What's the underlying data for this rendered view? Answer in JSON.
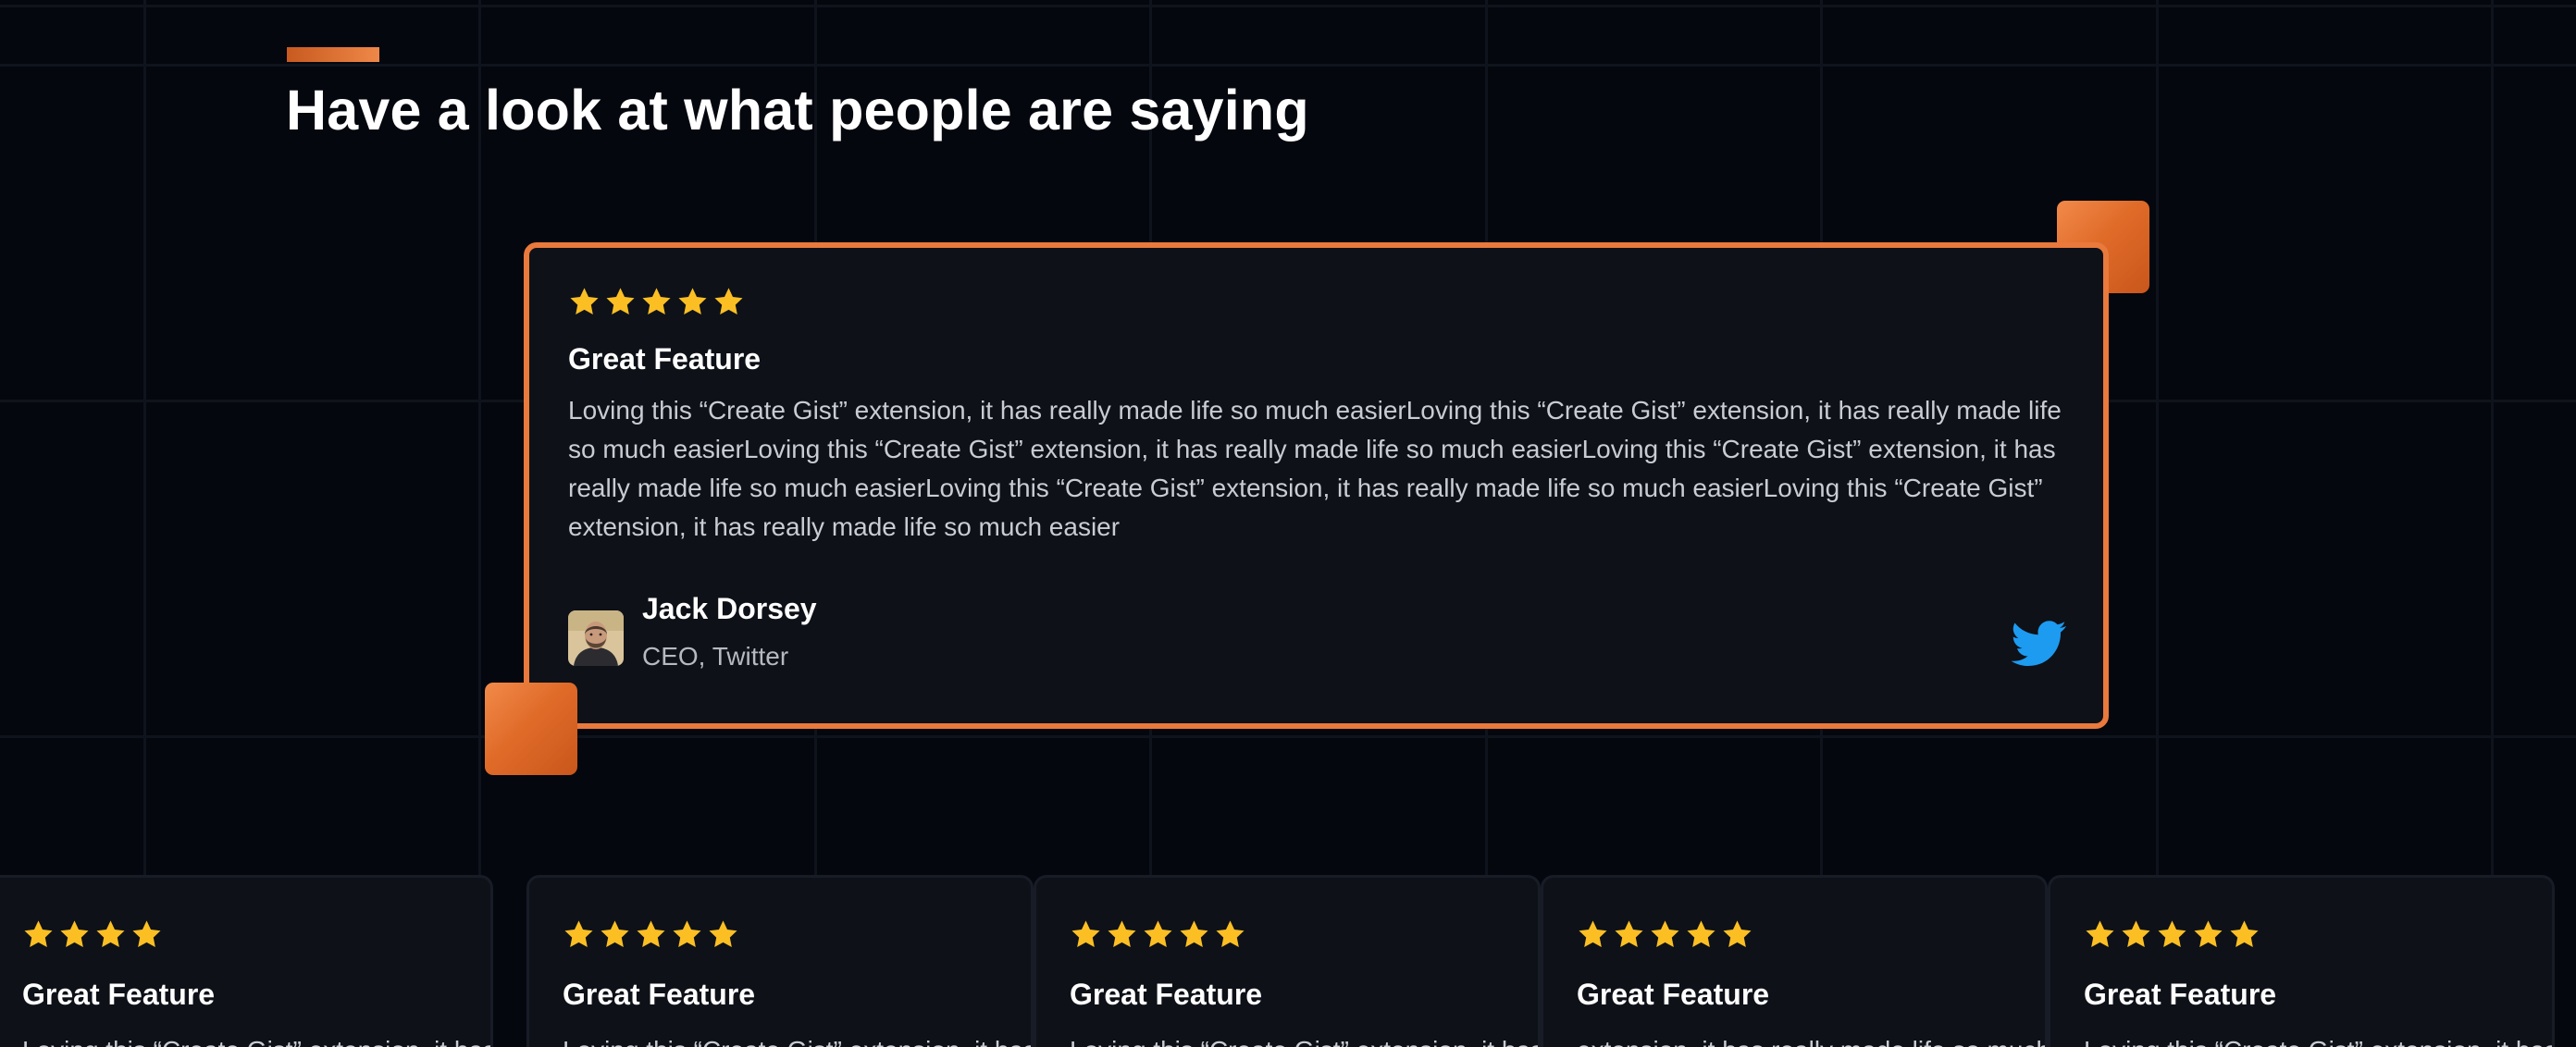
{
  "section": {
    "title": "Have a look at what people are saying"
  },
  "featured": {
    "rating": 5,
    "title": "Great Feature",
    "body": "Loving this “Create Gist” extension, it has really made life so much easierLoving this “Create Gist” extension, it has really made life so much easierLoving this “Create Gist” extension, it has really made life so much easierLoving this “Create Gist” extension, it has really made life so much easierLoving this “Create Gist” extension, it has really made life so much easierLoving this “Create Gist” extension, it has really made life so much easier",
    "author": {
      "name": "Jack Dorsey",
      "role": "CEO, Twitter"
    },
    "source_icon": "twitter-icon"
  },
  "cards": [
    {
      "rating": 4,
      "title": "Great Feature",
      "body": "Loving this “Create Gist” extension, it has really made life so much easier"
    },
    {
      "rating": 5,
      "title": "Great Feature",
      "body": "Loving this “Create Gist” extension, it has really made life so much easier"
    },
    {
      "rating": 5,
      "title": "Great Feature",
      "body": "Loving this “Create Gist” extension, it has really made life so much easier"
    },
    {
      "rating": 5,
      "title": "Great Feature",
      "body": "extension, it has really made life so much easier"
    },
    {
      "rating": 5,
      "title": "Great Feature",
      "body": "Loving this “Create Gist” extension, it has really made life so much easier"
    }
  ],
  "colors": {
    "accent": "#e9793c",
    "star": "#fbbf24",
    "twitter": "#1d9bf0",
    "background": "#05070e",
    "card": "#0e1118"
  }
}
